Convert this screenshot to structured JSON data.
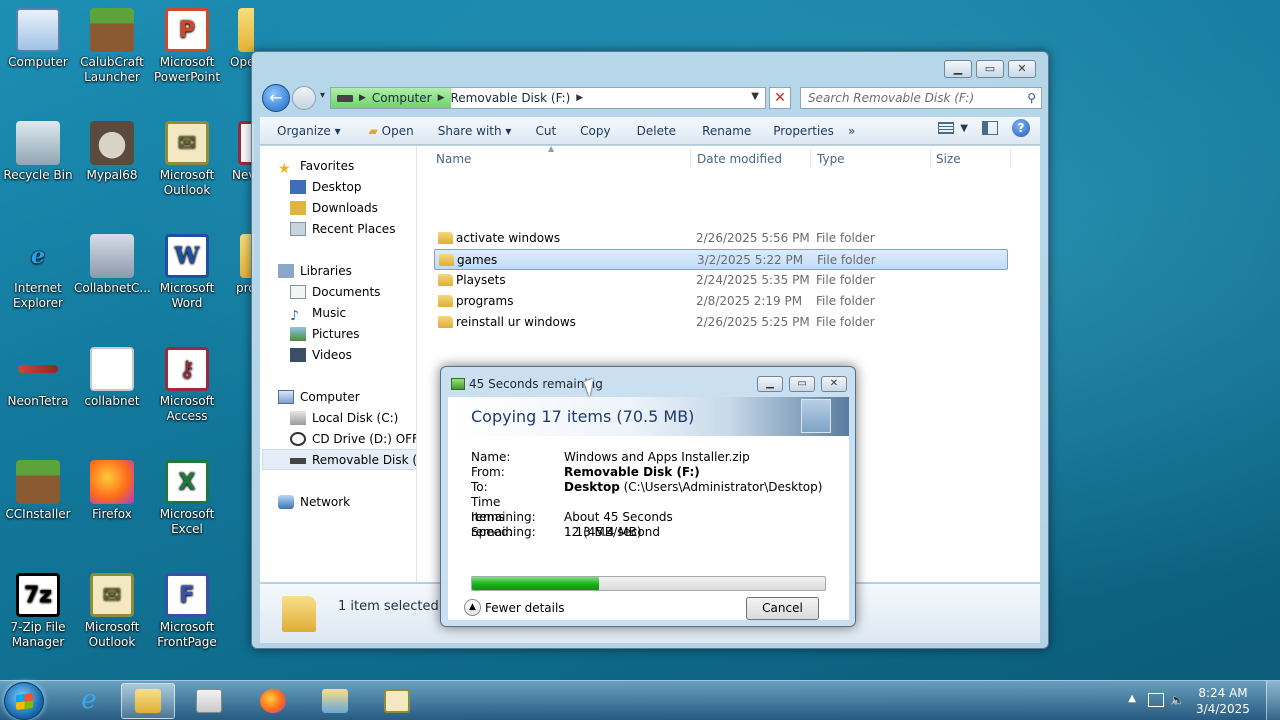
{
  "desktop": {
    "icons": [
      {
        "label": "Computer"
      },
      {
        "label": "CalubCraft Launcher"
      },
      {
        "label": "Microsoft PowerPoint"
      },
      {
        "label": "Ope Do"
      },
      {
        "label": "Recycle Bin"
      },
      {
        "label": "Mypal68"
      },
      {
        "label": "Microsoft Outlook"
      },
      {
        "label": "Nev Doc"
      },
      {
        "label": "Internet Explorer"
      },
      {
        "label": "CollabnetC..."
      },
      {
        "label": "Microsoft Word"
      },
      {
        "label": "pro"
      },
      {
        "label": "NeonTetra"
      },
      {
        "label": "collabnet"
      },
      {
        "label": "Microsoft Access"
      },
      {
        "label": "CCInstaller"
      },
      {
        "label": "Firefox"
      },
      {
        "label": "Microsoft Excel"
      },
      {
        "label": "7-Zip File Manager"
      },
      {
        "label": "Microsoft Outlook"
      },
      {
        "label": "Microsoft FrontPage"
      }
    ]
  },
  "explorer": {
    "address": {
      "part1": "Computer",
      "part2": "Removable Disk (F:)"
    },
    "search_placeholder": "Search Removable Disk (F:)",
    "toolbar": {
      "organize": "Organize ▾",
      "open": "Open",
      "share": "Share with ▾",
      "cut": "Cut",
      "copy": "Copy",
      "delete": "Delete",
      "rename": "Rename",
      "properties": "Properties",
      "more": "»"
    },
    "nav": {
      "favorites": "Favorites",
      "desktop": "Desktop",
      "downloads": "Downloads",
      "recent": "Recent Places",
      "libraries": "Libraries",
      "documents": "Documents",
      "music": "Music",
      "pictures": "Pictures",
      "videos": "Videos",
      "computer": "Computer",
      "local_disk": "Local Disk (C:)",
      "cd_drive": "CD Drive (D:) OFFICE",
      "removable": "Removable Disk (F:)",
      "network": "Network"
    },
    "columns": {
      "name": "Name",
      "date": "Date modified",
      "type": "Type",
      "size": "Size"
    },
    "files": [
      {
        "name": "activate windows",
        "date": "2/26/2025 5:56 PM",
        "type": "File folder"
      },
      {
        "name": "games",
        "date": "3/2/2025 5:22 PM",
        "type": "File folder"
      },
      {
        "name": "Playsets",
        "date": "2/24/2025 5:35 PM",
        "type": "File folder"
      },
      {
        "name": "programs",
        "date": "2/8/2025 2:19 PM",
        "type": "File folder"
      },
      {
        "name": "reinstall ur windows",
        "date": "2/26/2025 5:25 PM",
        "type": "File folder"
      }
    ],
    "status": "1 item selected"
  },
  "copy_dialog": {
    "title": "45 Seconds remaining",
    "heading": "Copying 17 items (70.5 MB)",
    "name_label": "Name:",
    "name_value": "Windows and Apps Installer.zip",
    "from_label": "From:",
    "from_value": "Removable Disk (F:)",
    "to_label": "To:",
    "to_bold": "Desktop",
    "to_path": "(C:\\Users\\Administrator\\Desktop)",
    "time_label": "Time remaining:",
    "time_value": "About 45 Seconds",
    "items_label": "Items remaining:",
    "items_value": "12 (45.4 MB)",
    "speed_label": "Speed:",
    "speed_value": "1.13 MB/second",
    "progress_percent": 36,
    "fewer_details": "Fewer details",
    "cancel": "Cancel"
  },
  "taskbar": {
    "clock_time": "8:24 AM",
    "clock_date": "3/4/2025"
  }
}
